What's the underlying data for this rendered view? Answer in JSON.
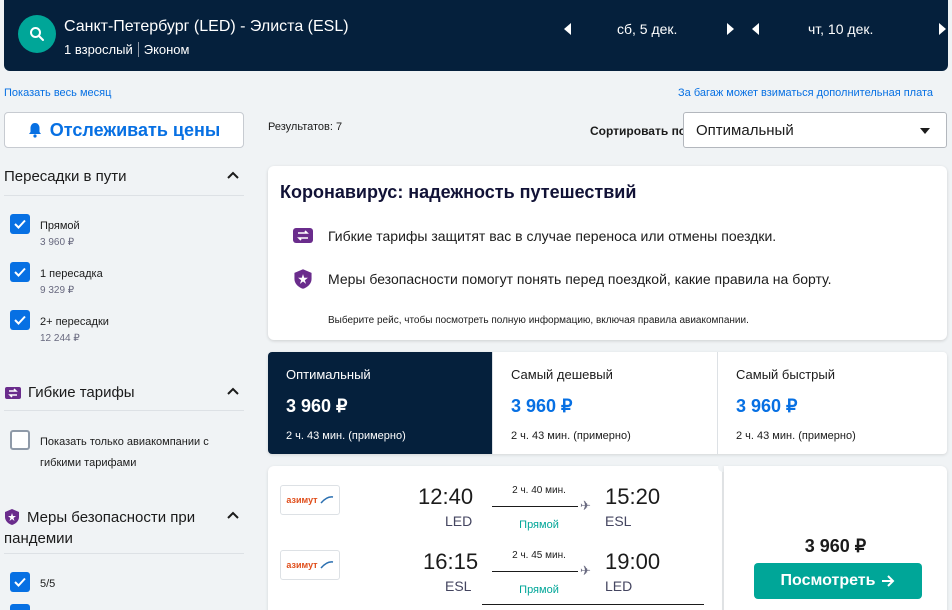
{
  "header": {
    "route": "Санкт-Петербург (LED) - Элиста (ESL)",
    "passengers": "1 взрослый",
    "cabin": "Эконом",
    "depart_date": "сб, 5 дек.",
    "return_date": "чт, 10 дек."
  },
  "links": {
    "show_month": "Показать весь месяц",
    "baggage_note": "За багаж может взиматься дополнительная плата"
  },
  "track_prices": "Отслеживать цены",
  "filters": {
    "stops": {
      "title": "Пересадки в пути",
      "options": [
        {
          "label": "Прямой",
          "price": "3 960 ₽",
          "checked": true
        },
        {
          "label": "1 пересадка",
          "price": "9 329 ₽",
          "checked": true
        },
        {
          "label": "2+ пересадки",
          "price": "12 244 ₽",
          "checked": true
        }
      ]
    },
    "flex": {
      "title": "Гибкие тарифы",
      "option_line1": "Показать только авиакомпании с",
      "option_line2": "гибкими тарифами"
    },
    "safety": {
      "title_line1": "Меры безопасности при",
      "title_line2": "пандемии",
      "option": "5/5"
    }
  },
  "results": {
    "count_text": "Результатов: 7",
    "sort_label": "Сортировать по",
    "sort_value": "Оптимальный"
  },
  "covid": {
    "title": "Коронавирус: надежность путешествий",
    "line1": "Гибкие тарифы защитят вас в случае переноса или отмены поездки.",
    "line2": "Меры безопасности помогут понять перед поездкой, какие правила на борту.",
    "note": "Выберите рейс, чтобы посмотреть полную информацию, включая правила авиакомпании."
  },
  "sort_tabs": [
    {
      "name": "Оптимальный",
      "price": "3 960 ₽",
      "duration": "2 ч. 43 мин. (примерно)"
    },
    {
      "name": "Самый дешевый",
      "price": "3 960 ₽",
      "duration": "2 ч. 43 мин. (примерно)"
    },
    {
      "name": "Самый быстрый",
      "price": "3 960 ₽",
      "duration": "2 ч. 43 мин. (примерно)"
    }
  ],
  "flight": {
    "airline": "азимут",
    "legs": [
      {
        "dep_time": "12:40",
        "dep_code": "LED",
        "duration": "2 ч. 40 мин.",
        "stops": "Прямой",
        "arr_time": "15:20",
        "arr_code": "ESL"
      },
      {
        "dep_time": "16:15",
        "dep_code": "ESL",
        "duration": "2 ч. 45 мин.",
        "stops": "Прямой",
        "arr_time": "19:00",
        "arr_code": "LED"
      }
    ],
    "price": "3 960 ₽",
    "button": "Посмотреть"
  },
  "colors": {
    "navy": "#05203c",
    "teal": "#00a698",
    "blue": "#0770e3",
    "airline_orange": "#e04e1b"
  }
}
